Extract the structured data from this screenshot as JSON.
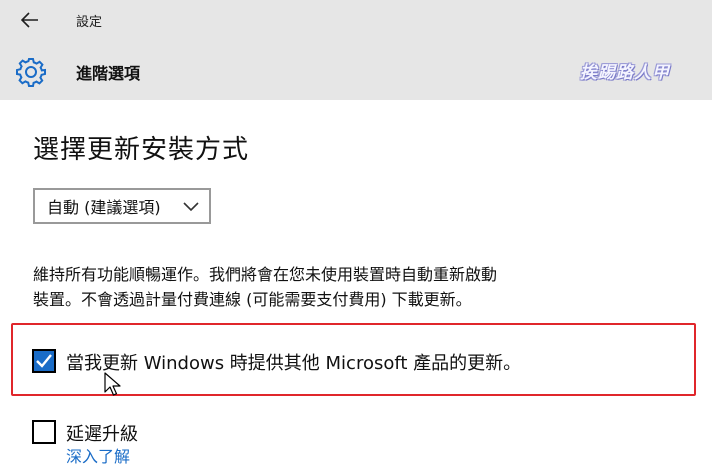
{
  "window": {
    "app_title": "設定",
    "back_icon": "arrow-left-icon"
  },
  "header": {
    "icon": "gear-icon",
    "title": "進階選項",
    "watermark": "挨踢路人甲",
    "accent_color": "#1a6cc7"
  },
  "main": {
    "section_title": "選擇更新安裝方式",
    "install_mode": {
      "selected": "自動 (建議選項)"
    },
    "description_lines": [
      "維持所有功能順暢運作。我們將會在您未使用裝置時自動重新啟動",
      "裝置。不會透過計量付費連線 (可能需要支付費用) 下載更新。"
    ],
    "options": [
      {
        "label": "當我更新 Windows 時提供其他 Microsoft 產品的更新。",
        "checked": true
      },
      {
        "label": "延遲升級",
        "checked": false
      }
    ],
    "learn_more": "深入了解",
    "highlight_color": "#e0262b"
  }
}
